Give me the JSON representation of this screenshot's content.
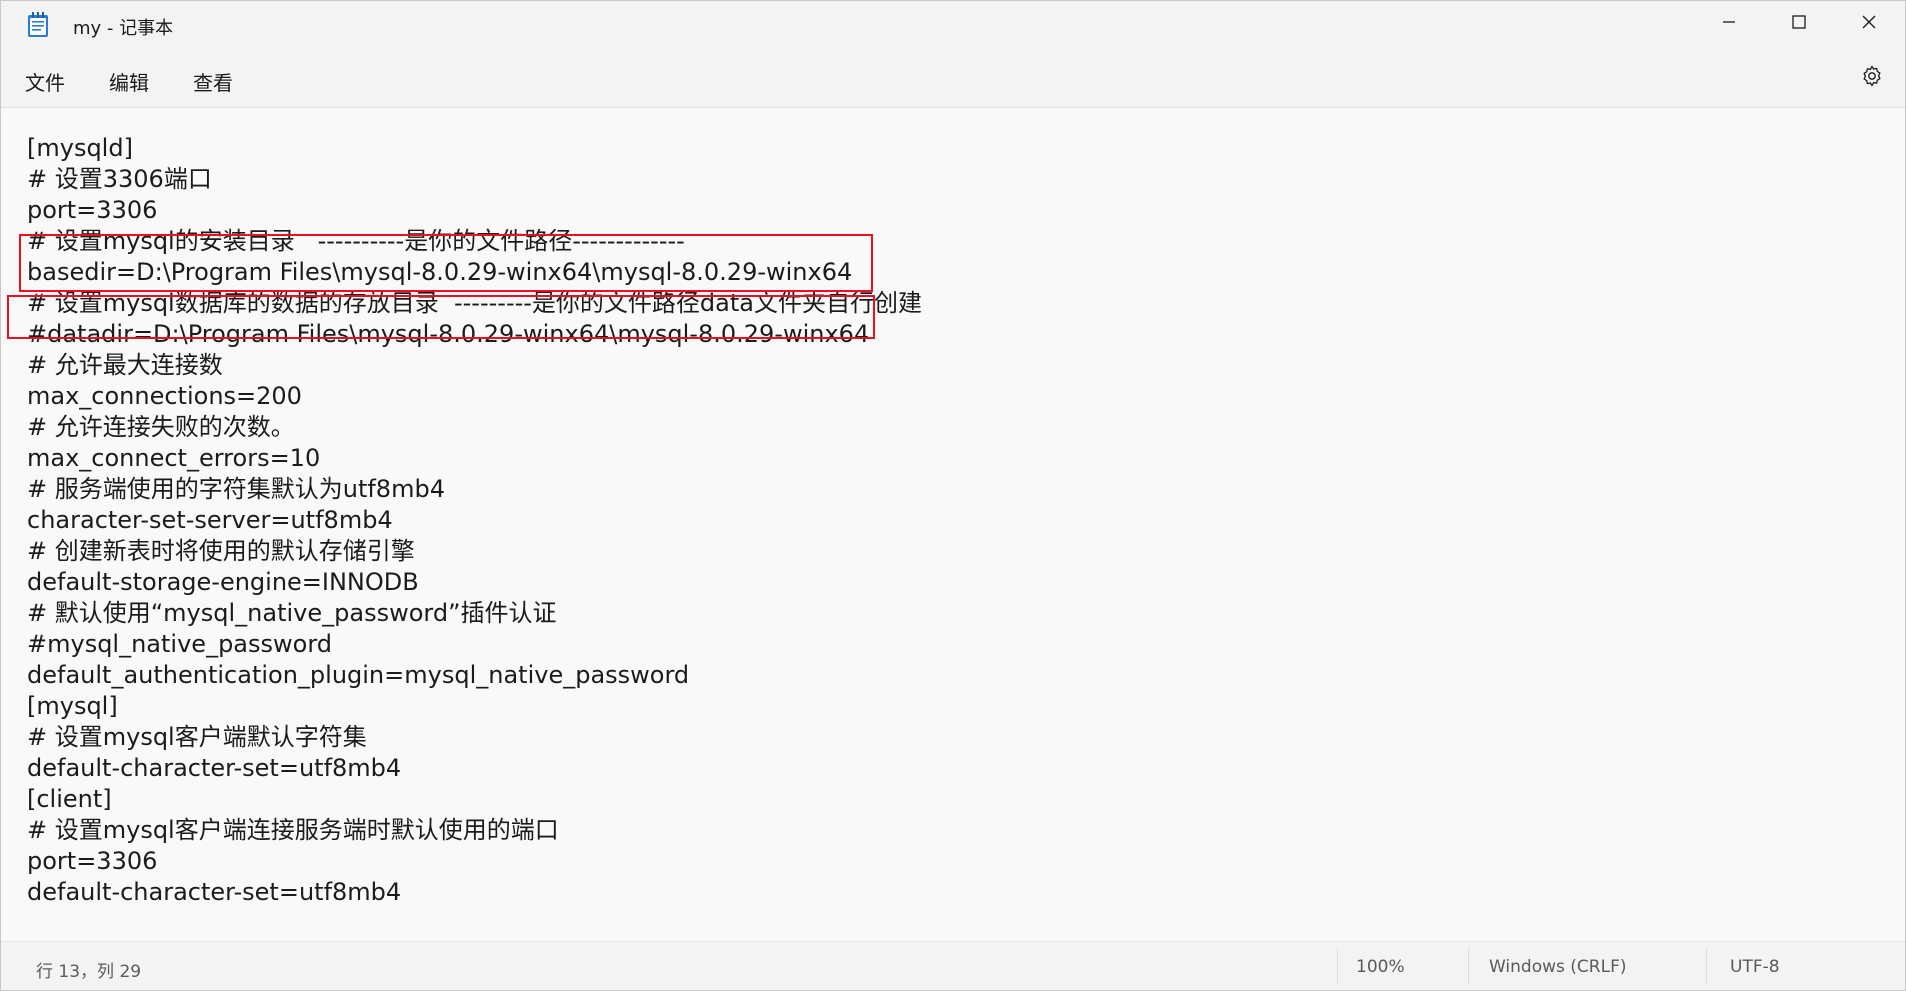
{
  "window": {
    "title": "my - 记事本"
  },
  "icons": {
    "app": "notepad-icon",
    "minimize": "minimize-icon",
    "maximize": "maximize-icon",
    "close": "close-icon",
    "settings": "gear-icon"
  },
  "menu": {
    "file": "文件",
    "edit": "编辑",
    "view": "查看"
  },
  "editor": {
    "lines": [
      "[mysqld]",
      "# 设置3306端口",
      "port=3306",
      "# 设置mysql的安装目录   ----------是你的文件路径-------------",
      "basedir=D:\\Program Files\\mysql-8.0.29-winx64\\mysql-8.0.29-winx64",
      "# 设置mysql数据库的数据的存放目录  ---------是你的文件路径data文件夹自行创建",
      "#datadir=D:\\Program Files\\mysql-8.0.29-winx64\\mysql-8.0.29-winx64",
      "# 允许最大连接数",
      "max_connections=200",
      "# 允许连接失败的次数。",
      "max_connect_errors=10",
      "# 服务端使用的字符集默认为utf8mb4",
      "character-set-server=utf8mb4",
      "# 创建新表时将使用的默认存储引擎",
      "default-storage-engine=INNODB",
      "# 默认使用“mysql_native_password”插件认证",
      "#mysql_native_password",
      "default_authentication_plugin=mysql_native_password",
      "[mysql]",
      "# 设置mysql客户端默认字符集",
      "default-character-set=utf8mb4",
      "[client]",
      "# 设置mysql客户端连接服务端时默认使用的端口",
      "port=3306",
      "default-character-set=utf8mb4"
    ]
  },
  "statusbar": {
    "position": "行 13，列 29",
    "zoom": "100%",
    "line_ending": "Windows (CRLF)",
    "encoding": "UTF-8"
  },
  "colors": {
    "highlight": "#e81123",
    "text": "#1b1b1b",
    "chrome": "#f3f3f3",
    "editor_bg": "#f9f9f9"
  }
}
